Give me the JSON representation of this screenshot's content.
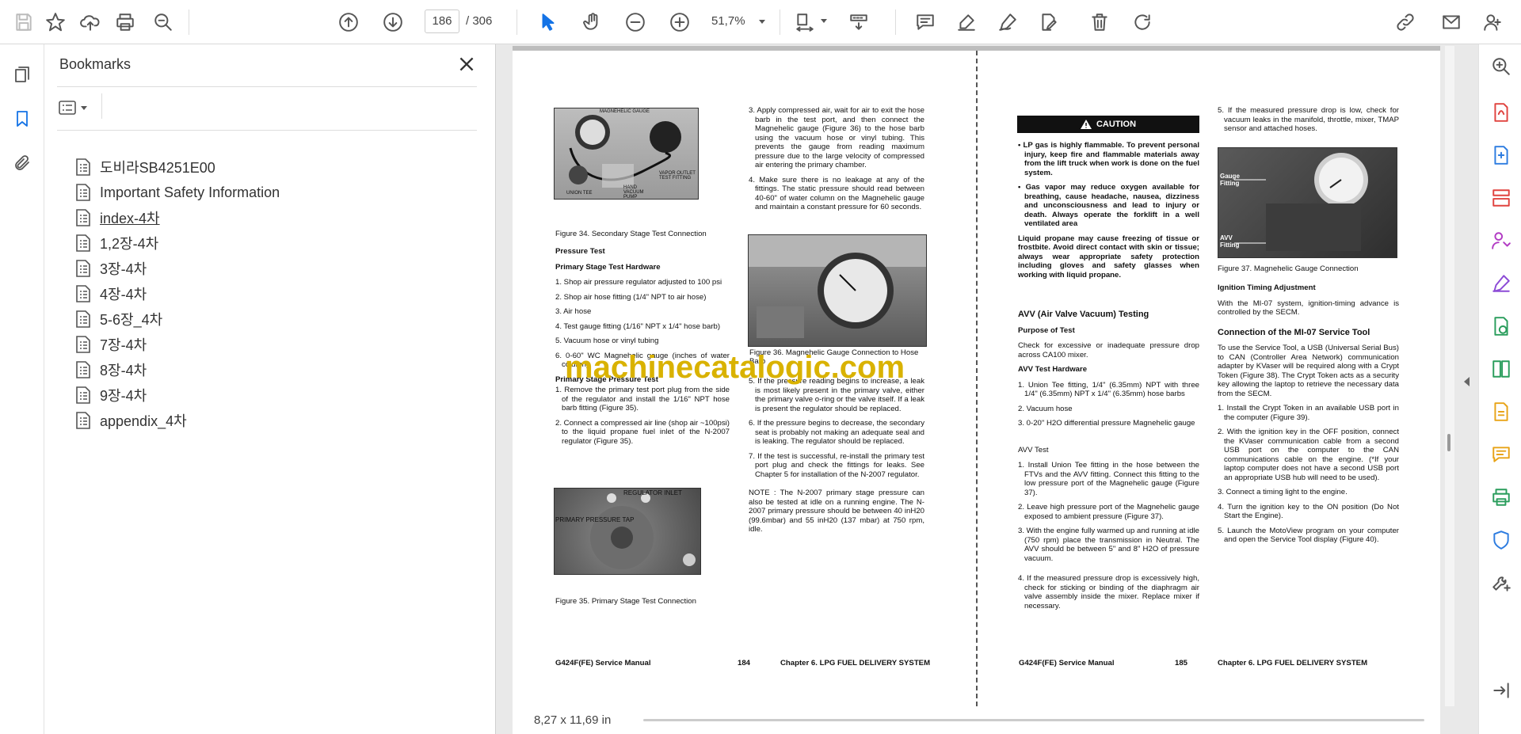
{
  "toolbar": {
    "page_current": "186",
    "page_total": "/ 306",
    "zoom": "51,7%",
    "icons": [
      "save-icon",
      "star-icon",
      "upload-icon",
      "print-icon",
      "zoom-search-icon",
      "page-up-icon",
      "page-down-icon",
      "select-cursor-icon",
      "hand-icon",
      "zoom-out-icon",
      "zoom-in-icon",
      "fit-page-icon",
      "scroll-mode-icon",
      "comment-icon",
      "highlight-icon",
      "sign-icon",
      "edit-icon",
      "delete-icon",
      "rotate-icon",
      "link-icon",
      "mail-icon",
      "account-icon"
    ]
  },
  "bookmarks": {
    "title": "Bookmarks",
    "items": [
      {
        "label": "도비라SB4251E00"
      },
      {
        "label": "Important Safety Information"
      },
      {
        "label": "index-4차"
      },
      {
        "label": "1,2장-4차"
      },
      {
        "label": "3장-4차"
      },
      {
        "label": "4장-4차"
      },
      {
        "label": "5-6장_4차"
      },
      {
        "label": "7장-4차"
      },
      {
        "label": "8장-4차"
      },
      {
        "label": "9장-4차"
      },
      {
        "label": "appendix_4차"
      }
    ]
  },
  "document": {
    "page_size": "8,27 x 11,69 in",
    "watermark": "machinecatalogic.com",
    "left": {
      "photo34_labels": [
        "MAGNEHELIC GAUGE",
        "VAPOR OUTLET TEST FITTING",
        "HAND VACUUM PUMP",
        "UNION TEE"
      ],
      "cap34": "Figure 34. Secondary Stage Test Connection",
      "h_pressure": "Pressure Test",
      "h_hardware": "Primary Stage Test Hardware",
      "hw": [
        "1. Shop air pressure regulator adjusted to 100 psi",
        "2. Shop air hose fitting (1/4\" NPT to air hose)",
        "3. Air hose",
        "4. Test gauge fitting (1/16\" NPT x 1/4\" hose barb)",
        "5. Vacuum hose or vinyl tubing",
        "6. 0-60\" WC Magnehelic gauge (inches of water column)"
      ],
      "h_pst": "Primary Stage Pressure Test",
      "pst": [
        "1. Remove the primary test port plug from the side of the regulator and install the 1/16\" NPT hose barb fitting (Figure 35).",
        "2. Connect a compressed air line (shop air ~100psi) to the liquid propane fuel inlet of the N-2007 regulator (Figure 35)."
      ],
      "photo35_labels": [
        "REGULATOR INLET",
        "PRIMARY PRESSURE TAP"
      ],
      "cap35": "Figure 35. Primary Stage Test Connection",
      "col2": [
        "3. Apply compressed air, wait for air to exit the hose barb in the test port, and then connect the Magnehelic gauge (Figure 36) to the hose barb using the vacuum hose or vinyl tubing. This prevents the gauge from reading maximum pressure due to the large velocity of compressed air entering the primary chamber.",
        "4. Make sure there is no leakage at any of the fittings. The static pressure should read between 40-60\" of water column on the Magnehelic gauge and maintain a constant pressure for 60 seconds."
      ],
      "cap36": "Figure 36. Magnehelic Gauge Connection to Hose Barb",
      "col2b": [
        "5. If the pressure reading begins to increase, a leak is most likely present in the primary valve, either the primary valve o-ring or the valve itself. If a leak is present the regulator should be replaced.",
        "6. If the pressure begins to decrease, the secondary seat is probably not making an adequate seal and is leaking. The regulator should be replaced.",
        "7. If the test is successful, re-install the primary test port plug and check the fittings for leaks. See Chapter 5 for installation of the N-2007 regulator."
      ],
      "note": "NOTE : The N-2007 primary stage pressure can also be tested at idle on a running engine. The N-2007 primary pressure should be between 40 inH20 (99.6mbar) and 55 inH20 (137 mbar) at 750 rpm, idle.",
      "foot_l": "G424F(FE) Service Manual",
      "foot_n": "184",
      "foot_r": "Chapter 6. LPG FUEL DELIVERY SYSTEM"
    },
    "right": {
      "caution": "CAUTION",
      "caution_items": [
        "• LP gas is highly flammable. To prevent personal injury, keep fire and flammable materials away from the lift truck when work is done on the fuel system.",
        "• Gas vapor may reduce oxygen available for breathing, cause headache, nausea, dizziness and unconsciousness and lead to injury or death. Always operate the forklift in a well ventilated area",
        "Liquid propane may cause freezing of tissue or frostbite. Avoid direct contact with skin or tissue; always wear appropriate safety protection including gloves and safety glasses when working with liquid propane."
      ],
      "h_avv": "AVV (Air Valve Vacuum) Testing",
      "h_purpose": "Purpose of Test",
      "purpose": "Check for excessive or inadequate pressure drop across CA100 mixer.",
      "h_avvhw": "AVV Test Hardware",
      "avvhw": [
        "1. Union Tee fitting, 1/4\" (6.35mm) NPT with three 1/4\" (6.35mm) NPT x 1/4\" (6.35mm) hose barbs",
        "2. Vacuum hose",
        "3. 0-20\" H2O differential pressure Magnehelic gauge"
      ],
      "h_avvtest": "AVV Test",
      "avvtest": [
        "1. Install Union Tee fitting in the hose between the FTVs and the AVV fitting. Connect this fitting to the low pressure port of the Magnehelic gauge (Figure 37).",
        "2. Leave high pressure port of the Magnehelic gauge exposed to ambient pressure (Figure 37).",
        "3. With the engine fully warmed up and running at idle (750 rpm) place the transmission in Neutral. The AVV should be between 5\" and 8\" H2O of pressure vacuum.",
        "4. If the measured pressure drop is excessively high, check for sticking or binding of the diaphragm air valve assembly inside the mixer. Replace mixer if necessary."
      ],
      "col2a": "5. If the measured pressure drop is low, check for vacuum leaks in the manifold, throttle, mixer, TMAP sensor and attached hoses.",
      "photo37_labels": [
        "Gauge Fitting",
        "AVV Fitting"
      ],
      "cap37": "Figure 37. Magnehelic Gauge Connection",
      "h_ign": "Ignition Timing Adjustment",
      "ign": "With the MI-07 system, ignition-timing advance is controlled by the SECM.",
      "h_conn": "Connection of the MI-07 Service Tool",
      "conn": "To use the Service Tool, a USB (Universal Serial Bus) to CAN (Controller Area Network) communication adapter by KVaser will be required along with a Crypt Token (Figure 38). The Crypt Token acts as a security key allowing the laptop to retrieve the necessary data from the SECM.",
      "steps": [
        "1. Install the Crypt Token in an available USB port in the computer (Figure 39).",
        "2. With the ignition key in the OFF position, connect the KVaser communication cable from a second USB port on the computer to the CAN communications cable on the engine. (*If your laptop computer does not have a second USB port an appropriate USB hub will need to be used).",
        "3. Connect a timing light to the engine.",
        "4. Turn the ignition key to the ON position (Do Not Start the Engine).",
        "5. Launch the MotoView program on your computer and open the Service Tool display (Figure 40)."
      ],
      "foot_l": "G424F(FE) Service Manual",
      "foot_n": "185",
      "foot_r": "Chapter 6. LPG FUEL DELIVERY SYSTEM"
    }
  },
  "colors": {
    "accent": "#1473e6",
    "caution_bg": "#111111",
    "watermark": "#d9b200"
  }
}
